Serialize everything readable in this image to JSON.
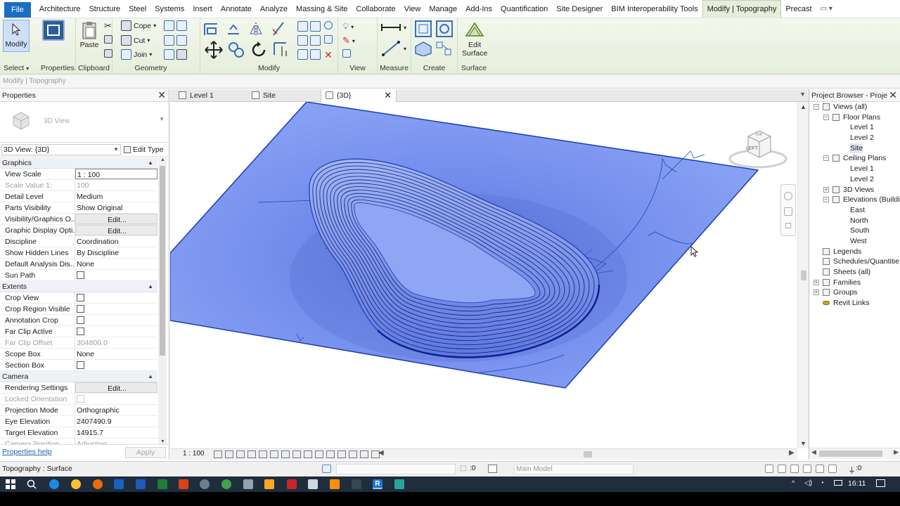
{
  "menu": {
    "file": "File",
    "items": [
      "Architecture",
      "Structure",
      "Steel",
      "Systems",
      "Insert",
      "Annotate",
      "Analyze",
      "Massing & Site",
      "Collaborate",
      "View",
      "Manage",
      "Add-Ins",
      "Quantification",
      "Site Designer",
      "BIM Interoperability Tools"
    ],
    "active_tab": "Modify | Topography",
    "extra": "Precast"
  },
  "ribbon": {
    "modify_label": "Modify",
    "select_label": "Select",
    "properties_label": "Properties",
    "clipboard_label": "Clipboard",
    "paste_label": "Paste",
    "cope_label": "Cope",
    "cut_label": "Cut",
    "join_label": "Join",
    "geometry_label": "Geometry",
    "modify_panel_label": "Modify",
    "view_label": "View",
    "measure_label": "Measure",
    "create_label": "Create",
    "edit_surface_line1": "Edit",
    "edit_surface_line2": "Surface",
    "surface_label": "Surface"
  },
  "options_bar": {
    "context": "Modify | Topography"
  },
  "properties": {
    "title": "Properties",
    "type_name": "3D View",
    "instance_selector": "3D View: {3D}",
    "edit_type": "Edit Type",
    "groups": [
      {
        "name": "Graphics",
        "rows": [
          {
            "name": "View Scale",
            "value": "1 : 100",
            "style": "box"
          },
          {
            "name": "Scale Value    1:",
            "value": "100",
            "disabled": true
          },
          {
            "name": "Detail Level",
            "value": "Medium"
          },
          {
            "name": "Parts Visibility",
            "value": "Show Original"
          },
          {
            "name": "Visibility/Graphics O...",
            "value": "Edit...",
            "style": "btn"
          },
          {
            "name": "Graphic Display Opti...",
            "value": "Edit...",
            "style": "btn"
          },
          {
            "name": "Discipline",
            "value": "Coordination"
          },
          {
            "name": "Show Hidden Lines",
            "value": "By Discipline"
          },
          {
            "name": "Default Analysis Dis...",
            "value": "None"
          },
          {
            "name": "Sun Path",
            "value": "",
            "check": true
          }
        ]
      },
      {
        "name": "Extents",
        "rows": [
          {
            "name": "Crop View",
            "value": "",
            "check": true
          },
          {
            "name": "Crop Region Visible",
            "value": "",
            "check": true
          },
          {
            "name": "Annotation Crop",
            "value": "",
            "check": true
          },
          {
            "name": "Far Clip Active",
            "value": "",
            "check": true
          },
          {
            "name": "Far Clip Offset",
            "value": "304800.0",
            "disabled": true
          },
          {
            "name": "Scope Box",
            "value": "None"
          },
          {
            "name": "Section Box",
            "value": "",
            "check": true
          }
        ]
      },
      {
        "name": "Camera",
        "rows": [
          {
            "name": "Rendering Settings",
            "value": "Edit...",
            "style": "btn"
          },
          {
            "name": "Locked Orientation",
            "value": "",
            "check": true,
            "disabled": true
          },
          {
            "name": "Projection Mode",
            "value": "Orthographic"
          },
          {
            "name": "Eye Elevation",
            "value": "2407490.9"
          },
          {
            "name": "Target Elevation",
            "value": "14915.7"
          },
          {
            "name": "Camera Position",
            "value": "Adjusting",
            "disabled": true
          }
        ]
      }
    ],
    "help_link": "Properties help",
    "apply": "Apply"
  },
  "view_tabs": [
    {
      "label": "Level 1",
      "active": false
    },
    {
      "label": "Site",
      "active": false
    },
    {
      "label": "{3D}",
      "active": true
    }
  ],
  "viewcube": {
    "face": "LEFT",
    "top": "TOP"
  },
  "view_control": {
    "scale": "1 : 100"
  },
  "browser": {
    "title": "Project Browser - Proje...",
    "tree": [
      {
        "label": "Views (all)",
        "level": 0,
        "exp": "−"
      },
      {
        "label": "Floor Plans",
        "level": 1,
        "exp": "−"
      },
      {
        "label": "Level 1",
        "level": 2
      },
      {
        "label": "Level 2",
        "level": 2
      },
      {
        "label": "Site",
        "level": 2,
        "selected": true
      },
      {
        "label": "Ceiling Plans",
        "level": 1,
        "exp": "−"
      },
      {
        "label": "Level 1",
        "level": 2
      },
      {
        "label": "Level 2",
        "level": 2
      },
      {
        "label": "3D Views",
        "level": 1,
        "exp": "+"
      },
      {
        "label": "Elevations (Building",
        "level": 1,
        "exp": "−"
      },
      {
        "label": "East",
        "level": 2
      },
      {
        "label": "North",
        "level": 2
      },
      {
        "label": "South",
        "level": 2
      },
      {
        "label": "West",
        "level": 2
      },
      {
        "label": "Legends",
        "level": 0
      },
      {
        "label": "Schedules/Quantitie",
        "level": 0
      },
      {
        "label": "Sheets (all)",
        "level": 0
      },
      {
        "label": "Families",
        "level": 0,
        "exp": "+"
      },
      {
        "label": "Groups",
        "level": 0,
        "exp": "+"
      },
      {
        "label": "Revit Links",
        "level": 0
      }
    ]
  },
  "status": {
    "text": "Topography : Surface",
    "workset_count": ":0",
    "model": "Main Model",
    "filter_count": ":0"
  },
  "taskbar": {
    "time": "16:11"
  },
  "colors": {
    "ribbon_bg": "#e6eedb",
    "file_tab": "#1b6ec2",
    "surface_fill": "#7c9cf0",
    "surface_edge": "#1c3bb5"
  }
}
